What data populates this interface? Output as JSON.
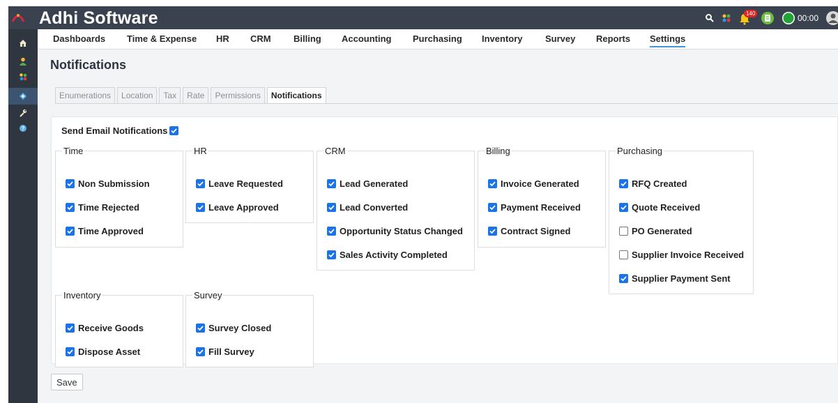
{
  "app": {
    "title": "Adhi Software"
  },
  "header": {
    "notification_count": "140",
    "timer": "00:00"
  },
  "rail": {
    "items": [
      "home-icon",
      "user-icon",
      "apps-icon",
      "settings-tag-icon",
      "wrench-icon",
      "help-icon"
    ]
  },
  "nav": {
    "items": [
      {
        "label": "Dashboards"
      },
      {
        "label": "Time & Expense"
      },
      {
        "label": "HR"
      },
      {
        "label": "CRM"
      },
      {
        "label": "Billing"
      },
      {
        "label": "Accounting"
      },
      {
        "label": "Purchasing"
      },
      {
        "label": "Inventory"
      },
      {
        "label": "Survey"
      },
      {
        "label": "Reports"
      },
      {
        "label": "Settings"
      }
    ],
    "active": "Settings"
  },
  "page": {
    "title": "Notifications"
  },
  "tabs": [
    {
      "label": "Enumerations"
    },
    {
      "label": "Location"
    },
    {
      "label": "Tax"
    },
    {
      "label": "Rate"
    },
    {
      "label": "Permissions"
    },
    {
      "label": "Notifications"
    }
  ],
  "send_email": {
    "label": "Send Email Notifications",
    "checked": true
  },
  "groups": {
    "time": {
      "legend": "Time",
      "items": [
        {
          "label": "Non Submission",
          "checked": true
        },
        {
          "label": "Time Rejected",
          "checked": true
        },
        {
          "label": "Time Approved",
          "checked": true
        }
      ]
    },
    "hr": {
      "legend": "HR",
      "items": [
        {
          "label": "Leave Requested",
          "checked": true
        },
        {
          "label": "Leave Approved",
          "checked": true
        }
      ]
    },
    "crm": {
      "legend": "CRM",
      "items": [
        {
          "label": "Lead Generated",
          "checked": true
        },
        {
          "label": "Lead Converted",
          "checked": true
        },
        {
          "label": "Opportunity Status Changed",
          "checked": true
        },
        {
          "label": "Sales Activity Completed",
          "checked": true
        }
      ]
    },
    "billing": {
      "legend": "Billing",
      "items": [
        {
          "label": "Invoice Generated",
          "checked": true
        },
        {
          "label": "Payment Received",
          "checked": true
        },
        {
          "label": "Contract Signed",
          "checked": true
        }
      ]
    },
    "purchasing": {
      "legend": "Purchasing",
      "items": [
        {
          "label": "RFQ Created",
          "checked": true
        },
        {
          "label": "Quote Received",
          "checked": true
        },
        {
          "label": "PO Generated",
          "checked": false
        },
        {
          "label": "Supplier Invoice Received",
          "checked": false
        },
        {
          "label": "Supplier Payment Sent",
          "checked": true
        }
      ]
    },
    "inventory": {
      "legend": "Inventory",
      "items": [
        {
          "label": "Receive Goods",
          "checked": true
        },
        {
          "label": "Dispose Asset",
          "checked": true
        }
      ]
    },
    "survey": {
      "legend": "Survey",
      "items": [
        {
          "label": "Survey Closed",
          "checked": true
        },
        {
          "label": "Fill Survey",
          "checked": true
        }
      ]
    }
  },
  "save": {
    "label": "Save"
  },
  "colors": {
    "header": "#3a4250",
    "rail": "#2f3640",
    "accent": "#1a73e8",
    "active_underline": "#3c96e0"
  }
}
